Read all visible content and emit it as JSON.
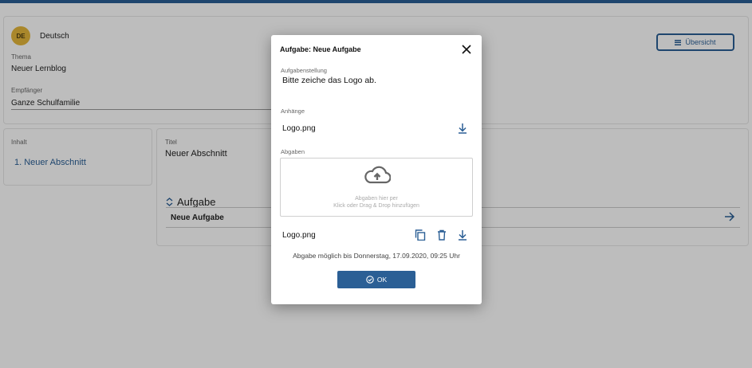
{
  "language": {
    "badge": "DE",
    "name": "Deutsch"
  },
  "header": {
    "overview_label": "Übersicht"
  },
  "form": {
    "topic_label": "Thema",
    "topic_value": "Neuer Lernblog",
    "recipient_label": "Empfänger",
    "recipient_value": "Ganze Schulfamilie"
  },
  "content": {
    "label": "Inhalt",
    "sections": [
      "1. Neuer Abschnitt"
    ]
  },
  "section": {
    "title_label": "Titel",
    "title_value": "Neuer Abschnitt",
    "task_heading": "Aufgabe",
    "task_name": "Neue Aufgabe"
  },
  "modal": {
    "title": "Aufgabe: Neue Aufgabe",
    "assignment_label": "Aufgabenstellung",
    "assignment_text": "Bitte zeiche das Logo ab.",
    "attachments_label": "Anhänge",
    "attachment_file": "Logo.png",
    "submissions_label": "Abgaben",
    "dropzone_line1": "Abgaben hier per",
    "dropzone_line2": "Klick oder Drag & Drop hinzufügen",
    "submission_file": "Logo.png",
    "deadline": "Abgabe möglich bis Donnerstag, 17.09.2020, 09:25 Uhr",
    "ok_label": "OK"
  },
  "colors": {
    "accent": "#2b5f95",
    "avatar": "#e5b73b"
  },
  "icons": [
    "list-icon",
    "close-icon",
    "download-icon",
    "cloud-upload-icon",
    "copy-icon",
    "trash-icon",
    "check-circle-icon",
    "arrow-right-icon",
    "expand-collapse-icon"
  ]
}
